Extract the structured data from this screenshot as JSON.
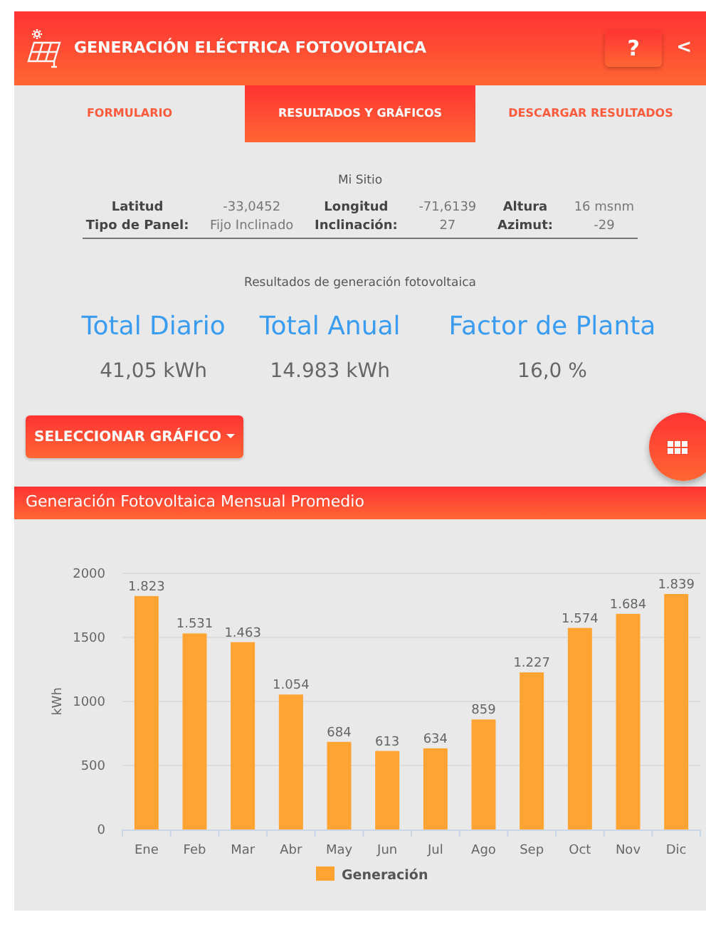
{
  "header": {
    "title": "GENERACIÓN ELÉCTRICA FOTOVOLTAICA",
    "help_button": "?",
    "back_button": "<"
  },
  "tabs": [
    {
      "label": "FORMULARIO",
      "selected": false
    },
    {
      "label": "RESULTADOS Y GRÁFICOS",
      "selected": true
    },
    {
      "label": "DESCARGAR RESULTADOS",
      "selected": false
    }
  ],
  "site": {
    "title": "Mi Sitio",
    "rows": [
      [
        {
          "label": "Latitud",
          "value": "-33,0452"
        },
        {
          "label": "Longitud",
          "value": "-71,6139"
        },
        {
          "label": "Altura",
          "value": "16 msnm"
        }
      ],
      [
        {
          "label": "Tipo de Panel:",
          "value": "Fijo Inclinado"
        },
        {
          "label": "Inclinación:",
          "value": "27"
        },
        {
          "label": "Azimut:",
          "value": "-29"
        }
      ]
    ]
  },
  "results": {
    "title": "Resultados de generación fotovoltaica",
    "items": [
      {
        "label": "Total Diario",
        "value": "41,05 kWh"
      },
      {
        "label": "Total Anual",
        "value": "14.983 kWh"
      },
      {
        "label": "Factor de Planta",
        "value": "16,0 %"
      }
    ]
  },
  "select_chart_button": "SELECCIONAR GRÁFICO",
  "chart_panel": {
    "title": "Generación Fotovoltaica Mensual Promedio",
    "chart_data": {
      "type": "bar",
      "ylabel": "kWh",
      "categories": [
        "Ene",
        "Feb",
        "Mar",
        "Abr",
        "May",
        "Jun",
        "Jul",
        "Ago",
        "Sep",
        "Oct",
        "Nov",
        "Dic"
      ],
      "series": [
        {
          "name": "Generación",
          "color": "#ffa333",
          "values": [
            1823,
            1531,
            1463,
            1054,
            684,
            613,
            634,
            859,
            1227,
            1574,
            1684,
            1839
          ]
        }
      ],
      "value_labels": [
        "1.823",
        "1.531",
        "1.463",
        "1.054",
        "684",
        "613",
        "634",
        "859",
        "1.227",
        "1.574",
        "1.684",
        "1.839"
      ],
      "grid": true,
      "ylim": [
        0,
        2000
      ],
      "yticks": [
        0,
        500,
        1000,
        1500,
        2000
      ]
    }
  }
}
